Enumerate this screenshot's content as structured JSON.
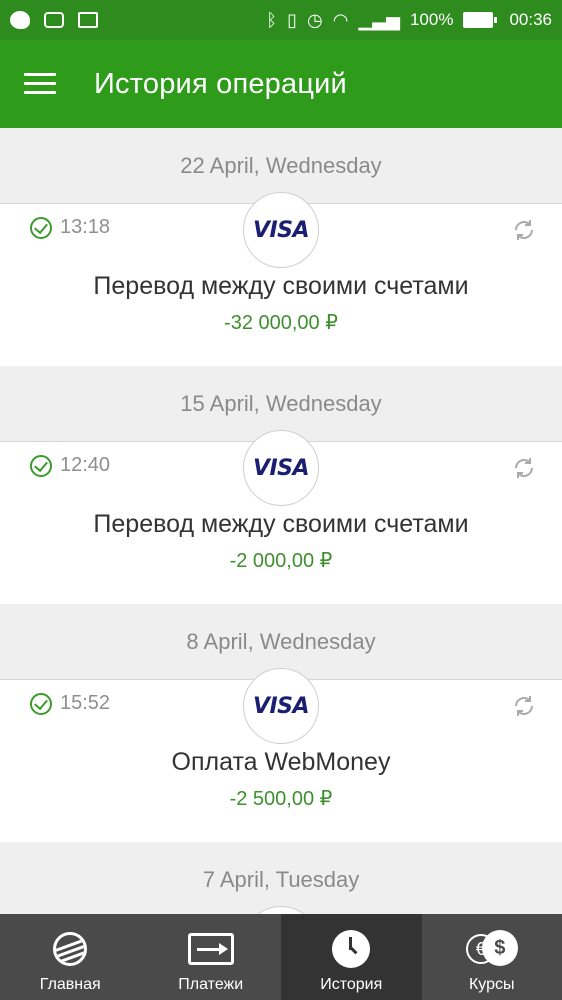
{
  "status_bar": {
    "battery": "100%",
    "time": "00:36"
  },
  "header": {
    "title": "История операций"
  },
  "operations": [
    {
      "date": "22 April, Wednesday",
      "time": "13:18",
      "card_brand": "VISA",
      "title": "Перевод между своими счетами",
      "amount": "-32 000,00 ₽"
    },
    {
      "date": "15 April, Wednesday",
      "time": "12:40",
      "card_brand": "VISA",
      "title": "Перевод между своими счетами",
      "amount": "-2 000,00 ₽"
    },
    {
      "date": "8 April, Wednesday",
      "time": "15:52",
      "card_brand": "VISA",
      "title": "Оплата WebMoney",
      "amount": "-2 500,00 ₽"
    },
    {
      "date": "7 April, Tuesday"
    }
  ],
  "bottom_nav": {
    "items": [
      {
        "label": "Главная",
        "icon": "sberbank-logo-icon"
      },
      {
        "label": "Платежи",
        "icon": "payments-icon"
      },
      {
        "label": "История",
        "icon": "clock-icon",
        "active": true
      },
      {
        "label": "Курсы",
        "icon": "currency-rates-icon"
      }
    ]
  },
  "colors": {
    "primary": "#2e9b1b",
    "status_bar": "#2e8b1e",
    "amount": "#3f8f2f",
    "nav_bg": "#4a4a4a",
    "nav_active": "#333333"
  }
}
